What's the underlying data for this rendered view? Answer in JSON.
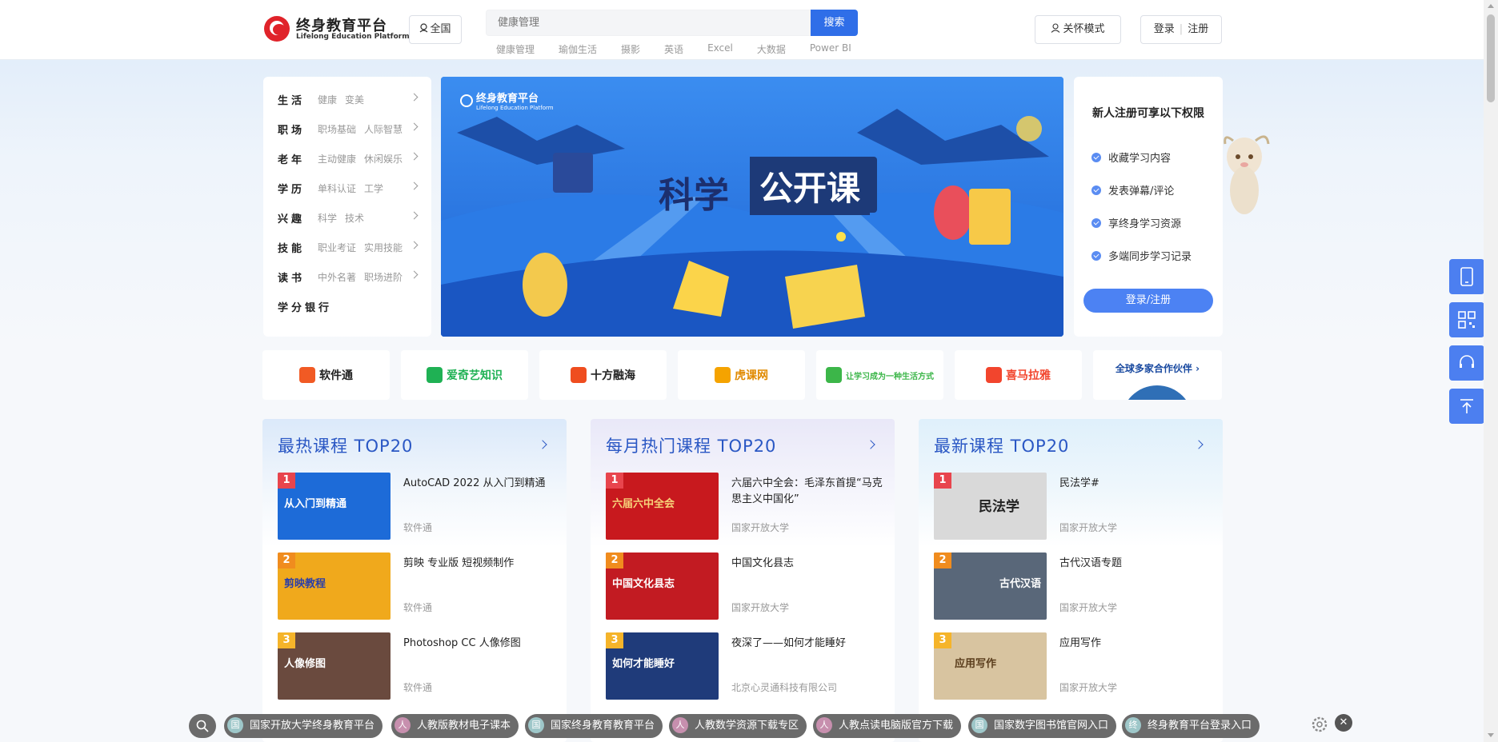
{
  "header": {
    "logo_title": "终身教育平台",
    "logo_sub": "Lifelong Education Platform",
    "region_label": "全国",
    "search_placeholder": "健康管理",
    "search_button": "搜索",
    "hot_words": [
      "健康管理",
      "瑜伽生活",
      "摄影",
      "英语",
      "Excel",
      "大数据",
      "Power BI"
    ],
    "care_mode": "关怀模式",
    "login": "登录",
    "register": "注册"
  },
  "categories": [
    {
      "name": "生活",
      "subs": [
        "健康",
        "变美"
      ]
    },
    {
      "name": "职场",
      "subs": [
        "职场基础",
        "人际智慧"
      ]
    },
    {
      "name": "老年",
      "subs": [
        "主动健康",
        "休闲娱乐"
      ]
    },
    {
      "name": "学历",
      "subs": [
        "单科认证",
        "工学"
      ]
    },
    {
      "name": "兴趣",
      "subs": [
        "科学",
        "技术"
      ]
    },
    {
      "name": "技能",
      "subs": [
        "职业考证",
        "实用技能"
      ]
    },
    {
      "name": "读书",
      "subs": [
        "中外名著",
        "职场进阶"
      ]
    },
    {
      "name": "学分银行",
      "subs": []
    }
  ],
  "banner": {
    "brand": "终身教育平台",
    "brand_sub": "Lifelong Education Platform",
    "headline_a": "科学",
    "headline_b": "公开课"
  },
  "benefits": {
    "title": "新人注册可享以下权限",
    "items": [
      "收藏学习内容",
      "发表弹幕/评论",
      "享终身学习资源",
      "多端同步学习记录"
    ],
    "button": "登录/注册"
  },
  "partners": [
    {
      "name": "软件通",
      "color": "#f15a24"
    },
    {
      "name": "爱奇艺知识",
      "color": "#1fb154"
    },
    {
      "name": "十方融海",
      "color": "#ef4d1f"
    },
    {
      "name": "虎课网",
      "color": "#f5a300"
    },
    {
      "name": "让学习成为一种生活方式",
      "color": "#3cb649"
    },
    {
      "name": "喜马拉雅",
      "color": "#f2452d"
    },
    {
      "name": "全球多家合作伙伴",
      "color": "#1a4aa0"
    }
  ],
  "columns": [
    {
      "title": "最热课程 TOP20",
      "bg": "#e2eefb",
      "courses": [
        {
          "rank": "1",
          "title": "AutoCAD 2022 从入门到精通",
          "source": "软件通",
          "thumb_text": "从入门到精通",
          "thumb_bg": "#1d6bd8"
        },
        {
          "rank": "2",
          "title": "剪映 专业版 短视频制作",
          "source": "软件通",
          "thumb_text": "剪映教程",
          "thumb_bg": "#f0a91c"
        },
        {
          "rank": "3",
          "title": "Photoshop CC 人像修图",
          "source": "软件通",
          "thumb_text": "人像修图",
          "thumb_bg": "#6a4a3e"
        }
      ]
    },
    {
      "title": "每月热门课程 TOP20",
      "bg": "#ebeaf8",
      "courses": [
        {
          "rank": "1",
          "title": "六届六中全会：毛泽东首提“马克思主义中国化”",
          "source": "国家开放大学",
          "thumb_text": "六届六中全会",
          "thumb_bg": "#c8191e"
        },
        {
          "rank": "2",
          "title": "中国文化县志",
          "source": "国家开放大学",
          "thumb_text": "中国文化县志",
          "thumb_bg": "#c21b22"
        },
        {
          "rank": "3",
          "title": "夜深了——如何才能睡好",
          "source": "北京心灵通科技有限公司",
          "thumb_text": "如何才能睡好",
          "thumb_bg": "#1f3b7a"
        }
      ]
    },
    {
      "title": "最新课程 TOP20",
      "bg": "#e4f2fb",
      "courses": [
        {
          "rank": "1",
          "title": "民法学#",
          "source": "国家开放大学",
          "thumb_text": "民法学",
          "thumb_bg": "#d9d9d9"
        },
        {
          "rank": "2",
          "title": "古代汉语专题",
          "source": "国家开放大学",
          "thumb_text": "古代汉语",
          "thumb_bg": "#596779"
        },
        {
          "rank": "3",
          "title": "应用写作",
          "source": "国家开放大学",
          "thumb_text": "应用写作",
          "thumb_bg": "#d8c4a0"
        }
      ]
    }
  ],
  "bottom_bar": [
    {
      "icon": "国",
      "label": "国家开放大学终身教育平台"
    },
    {
      "icon": "人",
      "label": "人教版教材电子课本"
    },
    {
      "icon": "国",
      "label": "国家终身教育教育平台"
    },
    {
      "icon": "人",
      "label": "人教数学资源下载专区"
    },
    {
      "icon": "人",
      "label": "人教点读电脑版官方下载"
    },
    {
      "icon": "国",
      "label": "国家数字图书馆官网入口"
    },
    {
      "icon": "终",
      "label": "终身教育平台登录入口"
    }
  ],
  "colors": {
    "accent": "#2f6ee8",
    "rank1": "#e8454d",
    "rank2": "#f08c1e",
    "rank3": "#f5b42a"
  }
}
